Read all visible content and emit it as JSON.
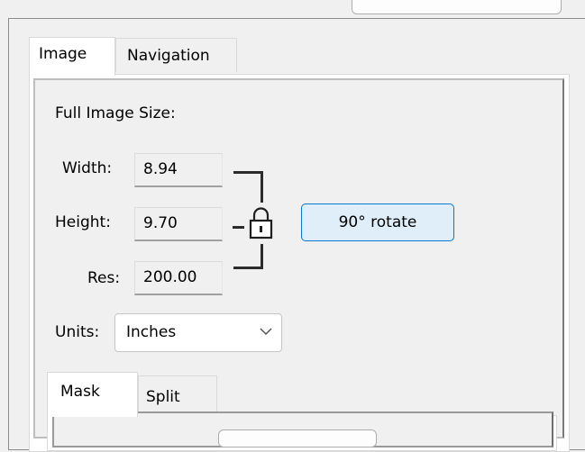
{
  "tabs": {
    "image": "Image",
    "navigation": "Navigation"
  },
  "image_panel": {
    "section_label": "Full Image Size:",
    "width_label": "Width:",
    "width_value": "8.94",
    "height_label": "Height:",
    "height_value": "9.70",
    "res_label": "Res:",
    "res_value": "200.00",
    "rotate_button": "90° rotate",
    "units_label": "Units:",
    "units_value": "Inches",
    "aspect_lock_icon": "padlock-icon",
    "units_dropdown_icon": "chevron-down-icon"
  },
  "sub_tabs": {
    "mask": "Mask",
    "split": "Split"
  },
  "colors": {
    "window_bg": "#f0f0f0",
    "tab_active_bg": "#ffffff",
    "button_accent_border": "#0078d4",
    "button_accent_bg": "#e0eef9"
  }
}
